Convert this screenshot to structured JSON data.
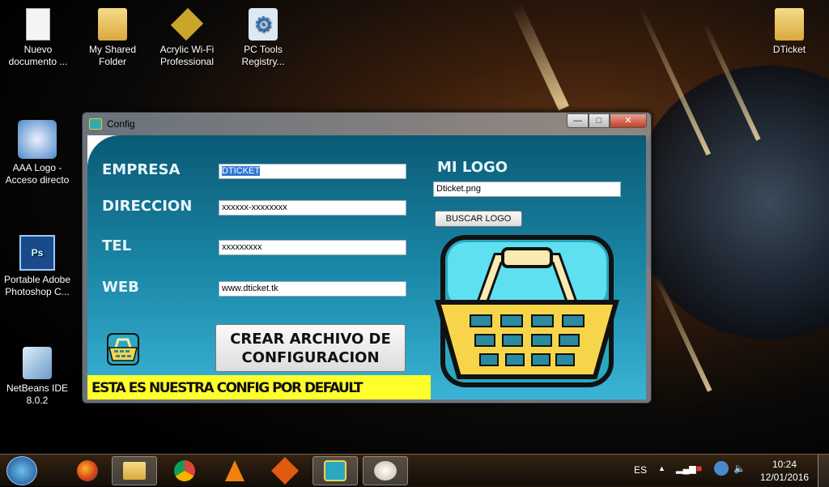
{
  "desktop": {
    "icons": [
      {
        "label": "Nuevo documento ...",
        "icon": "text-document-icon"
      },
      {
        "label": "My Shared Folder",
        "icon": "folder-icon"
      },
      {
        "label": "Acrylic Wi-Fi Professional",
        "icon": "acrylic-wifi-icon"
      },
      {
        "label": "PC Tools Registry...",
        "icon": "pc-tools-icon"
      },
      {
        "label": "DTicket",
        "icon": "folder-icon"
      },
      {
        "label": "AAA Logo - Acceso directo",
        "icon": "aaa-logo-icon"
      },
      {
        "label": "Portable Adobe Photoshop C...",
        "icon": "photoshop-icon"
      },
      {
        "label": "NetBeans IDE 8.0.2",
        "icon": "netbeans-icon"
      }
    ]
  },
  "window": {
    "title": "Config",
    "controls": {
      "minimize": "—",
      "maximize": "□",
      "close": "✕"
    },
    "form": {
      "empresa_label": "EMPRESA",
      "empresa_value": "DTICKET",
      "direccion_label": "DIRECCION",
      "direccion_value": "xxxxxx-xxxxxxxx",
      "tel_label": "TEL",
      "tel_value": "xxxxxxxxx",
      "web_label": "WEB",
      "web_value": "www.dticket.tk"
    },
    "logo": {
      "label": "MI LOGO",
      "file": "Dticket.png",
      "browse_button": "BUSCAR LOGO"
    },
    "create_button": "CREAR ARCHIVO DE CONFIGURACION",
    "banner": "ESTA ES NUESTRA CONFIG POR DEFAULT",
    "colors": {
      "teal_dark": "#0a5a74",
      "teal_light": "#3ab4d6",
      "banner": "#ffff2a"
    }
  },
  "taskbar": {
    "apps": [
      "start-orb",
      "firefox",
      "file-explorer",
      "chrome",
      "vlc",
      "app-flame",
      "dticket-config",
      "paint"
    ],
    "language": "ES",
    "time": "10:24",
    "date": "12/01/2016"
  }
}
